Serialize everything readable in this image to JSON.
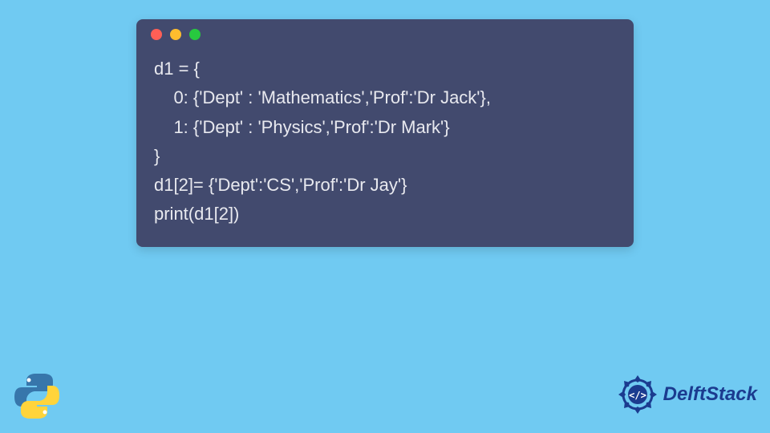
{
  "window": {
    "dots": [
      "red",
      "yellow",
      "green"
    ]
  },
  "code": {
    "line1": "d1 = {",
    "line2": "    0: {'Dept' : 'Mathematics','Prof':'Dr Jack'},",
    "line3": "    1: {'Dept' : 'Physics','Prof':'Dr Mark'}",
    "line4": "}",
    "line5": "d1[2]= {'Dept':'CS','Prof':'Dr Jay'}",
    "line6": "print(d1[2])"
  },
  "brand": {
    "name": "DelftStack"
  },
  "icons": {
    "python": "python-logo",
    "delftstack": "delftstack-medallion"
  }
}
